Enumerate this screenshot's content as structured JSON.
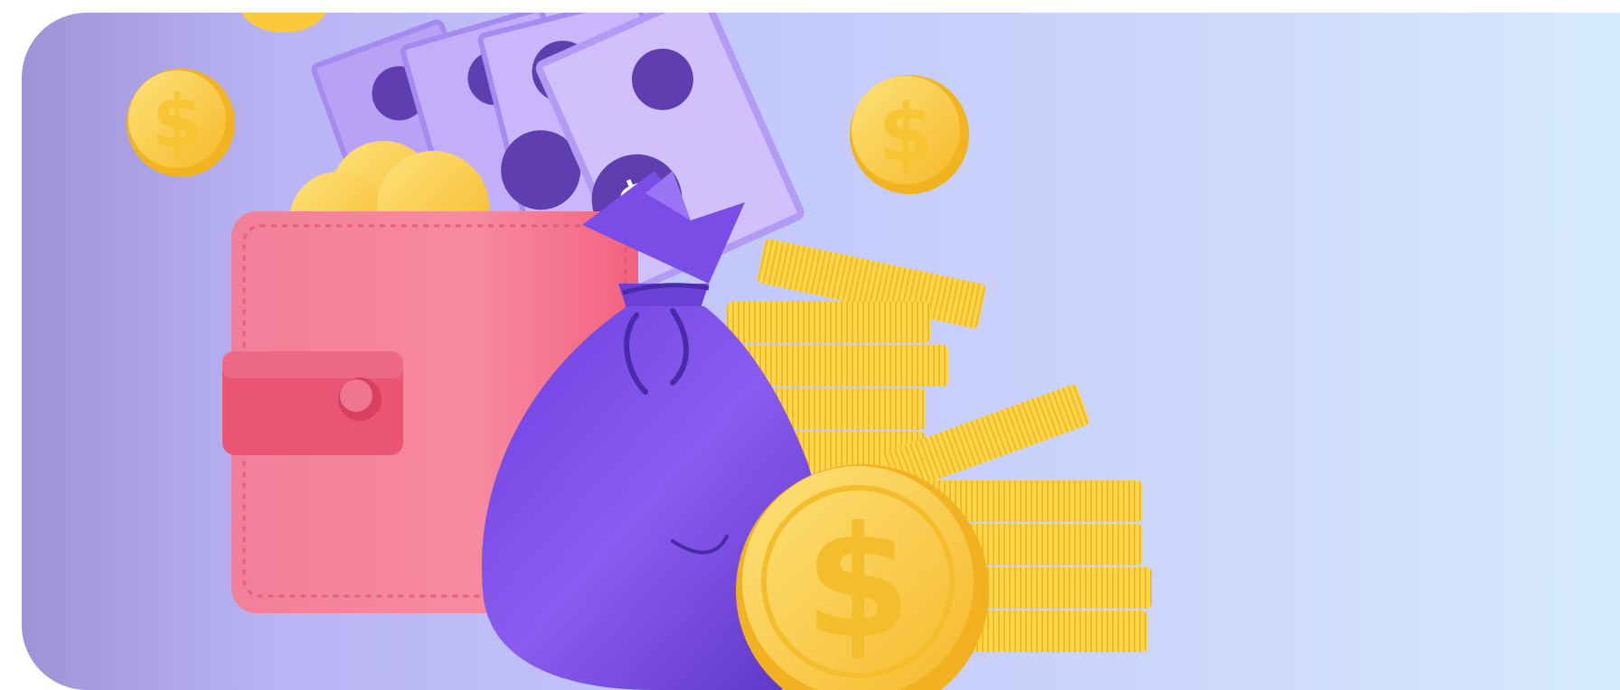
{
  "illustration": {
    "theme": "wallet-money-bag-coins",
    "coin_symbol": "$",
    "colors": {
      "background_left": "#9f92d6",
      "background_right": "#d6ebfd",
      "wallet": "#f56f89",
      "wallet_strap": "#e95573",
      "bill": "#c9b6fb",
      "bill_dot": "#5f3fb0",
      "bag": "#7a4ee6",
      "bag_dark": "#5e37c6",
      "coin": "#fbc93a",
      "coin_light": "#fde27a",
      "coin_edge": "#f2b120"
    },
    "icons": [
      "wallet-icon",
      "money-bag-icon",
      "banknote-icon",
      "coin-icon",
      "coin-stack-icon"
    ]
  }
}
